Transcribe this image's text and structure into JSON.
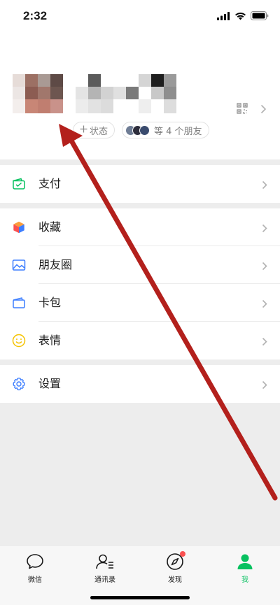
{
  "status_bar": {
    "time": "2:32"
  },
  "profile": {
    "status_label": "状态",
    "friends_label": "等 4 个朋友"
  },
  "menu": {
    "pay": "支付",
    "favorites": "收藏",
    "moments": "朋友圈",
    "cards": "卡包",
    "stickers": "表情",
    "settings": "设置"
  },
  "tabbar": {
    "chats": "微信",
    "contacts": "通讯录",
    "discover": "发现",
    "me": "我"
  },
  "colors": {
    "accent_green": "#07c160",
    "annotation_arrow": "#b3201c",
    "badge_red": "#fa5151"
  }
}
